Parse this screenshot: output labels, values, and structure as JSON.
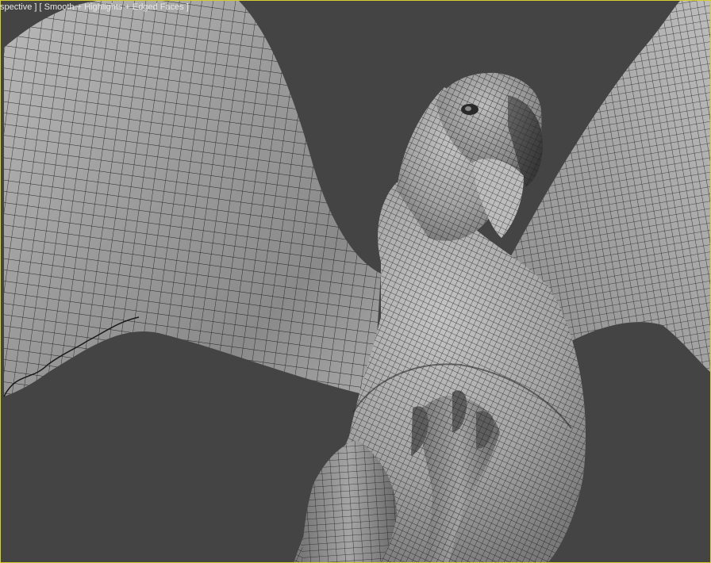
{
  "viewport": {
    "label_segments": [
      "spective ]",
      " [ ",
      "Smooth + Highlights + Edged Faces",
      " ]"
    ],
    "border_color": "#d6cf2e",
    "background_color": "#444444"
  },
  "scene": {
    "subject": "griffin-wireframe-mesh",
    "shading": "Smooth + Highlights + Edged Faces"
  }
}
